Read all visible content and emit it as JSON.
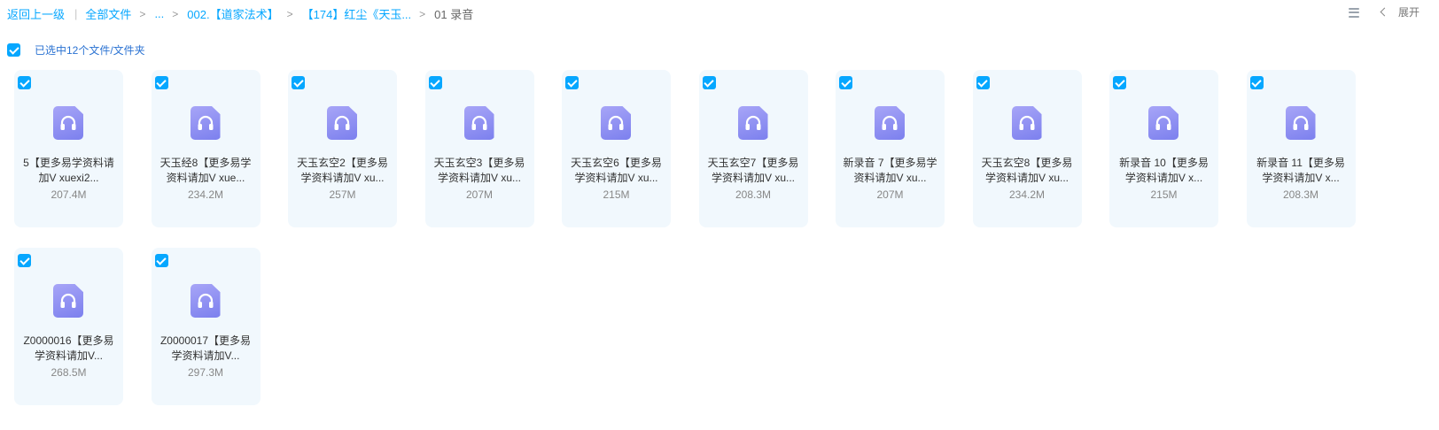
{
  "breadcrumb": {
    "back": "返回上一级",
    "all_files": "全部文件",
    "ellipsis": "...",
    "folder1": "002.【道家法术】",
    "folder2": "【174】红尘《天玉...",
    "current": "01 录音",
    "separator": ">"
  },
  "toolbar": {
    "expand": "展开"
  },
  "selection": {
    "text": "已选中12个文件/文件夹"
  },
  "colors": {
    "accent": "#06a7ff",
    "card_bg": "#f1f8fd",
    "icon": "#8b8ef2"
  },
  "files": [
    {
      "name": "5【更多易学资料请加V xuexi2...",
      "size": "207.4M",
      "icon": "headphones-icon"
    },
    {
      "name": "天玉经8【更多易学资料请加V xue...",
      "size": "234.2M",
      "icon": "headphones-icon"
    },
    {
      "name": "天玉玄空2【更多易学资料请加V xu...",
      "size": "257M",
      "icon": "headphones-icon"
    },
    {
      "name": "天玉玄空3【更多易学资料请加V xu...",
      "size": "207M",
      "icon": "headphones-icon"
    },
    {
      "name": "天玉玄空6【更多易学资料请加V xu...",
      "size": "215M",
      "icon": "headphones-icon"
    },
    {
      "name": "天玉玄空7【更多易学资料请加V xu...",
      "size": "208.3M",
      "icon": "headphones-icon"
    },
    {
      "name": "新录音 7【更多易学资料请加V xu...",
      "size": "207M",
      "icon": "headphones-icon"
    },
    {
      "name": "天玉玄空8【更多易学资料请加V xu...",
      "size": "234.2M",
      "icon": "headphones-icon"
    },
    {
      "name": "新录音 10【更多易学资料请加V x...",
      "size": "215M",
      "icon": "headphones-icon"
    },
    {
      "name": "新录音 11【更多易学资料请加V x...",
      "size": "208.3M",
      "icon": "headphones-icon"
    },
    {
      "name": "Z0000016【更多易学资料请加V...",
      "size": "268.5M",
      "icon": "headphones-icon"
    },
    {
      "name": "Z0000017【更多易学资料请加V...",
      "size": "297.3M",
      "icon": "headphones-icon"
    }
  ]
}
